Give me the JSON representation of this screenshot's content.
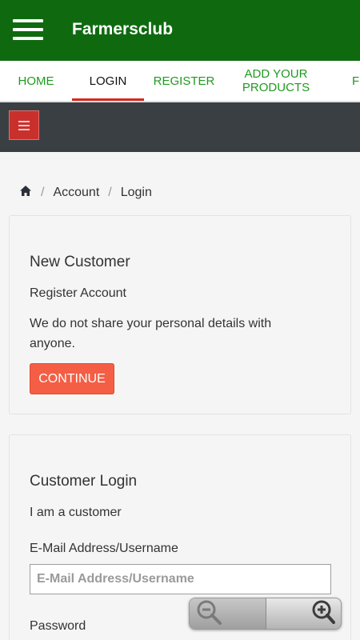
{
  "appbar": {
    "title": "Farmersclub",
    "menu_icon": "hamburger-icon"
  },
  "tabs": [
    {
      "label": "HOME",
      "active": false
    },
    {
      "label": "LOGIN",
      "active": true
    },
    {
      "label": "REGISTER",
      "active": false
    },
    {
      "label": "ADD YOUR PRODUCTS",
      "active": false
    },
    {
      "label": "F",
      "active": false
    }
  ],
  "toolbar": {
    "toggle_icon": "hamburger-icon",
    "toggle_color": "#c9302c"
  },
  "breadcrumb": {
    "home_icon": "home-icon",
    "account": "Account",
    "separator": "/",
    "current": "Login"
  },
  "new_customer": {
    "title": "New Customer",
    "subtitle": "Register Account",
    "description": "We do not share your personal details with anyone.",
    "continue_label": "CONTINUE"
  },
  "customer_login": {
    "title": "Customer Login",
    "subtitle": "I am a customer",
    "email_label": "E-Mail Address/Username",
    "email_placeholder": "E-Mail Address/Username",
    "email_value": "",
    "password_label": "Password"
  },
  "zoom": {
    "out_icon": "zoom-out-icon",
    "in_icon": "zoom-in-icon"
  },
  "colors": {
    "appbar": "#0f6a0f",
    "tab_text": "#1f9a1f",
    "tab_indicator": "#d9281f",
    "darkbar": "#3a3f44",
    "continue_button": "#f45e45"
  }
}
